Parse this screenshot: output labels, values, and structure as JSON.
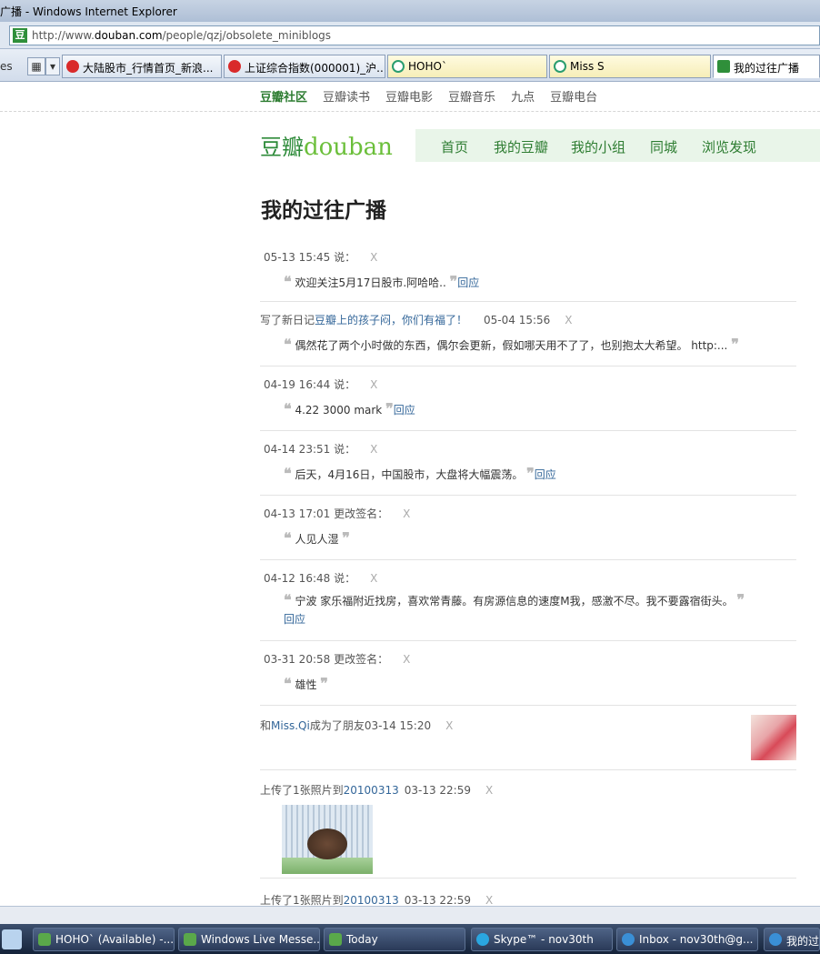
{
  "window": {
    "title": "广播 - Windows Internet Explorer",
    "url_prefix": "http://www.",
    "url_domain": "douban.com",
    "url_path": "/people/qzj/obsolete_miniblogs"
  },
  "tabs": {
    "left_stub": "es",
    "items": [
      {
        "label": "大陆股市_行情首页_新浪..."
      },
      {
        "label": "上证综合指数(000001)_沪..."
      },
      {
        "label": "HOHO`"
      },
      {
        "label": "Miss S"
      },
      {
        "label": "我的过往广播"
      }
    ]
  },
  "site": {
    "community_nav": [
      "豆瓣社区",
      "豆瓣读书",
      "豆瓣电影",
      "豆瓣音乐",
      "九点",
      "豆瓣电台"
    ],
    "logo_cn": "豆瓣",
    "logo_en": "douban",
    "main_nav": [
      "首页",
      "我的豆瓣",
      "我的小组",
      "同城",
      "浏览发现"
    ]
  },
  "page_title": "我的过往广播",
  "entries": [
    {
      "meta": "05-13 15:45 说：",
      "x": "X",
      "text": "欢迎关注5月17日股市.阿哈哈..",
      "reply": "回应"
    },
    {
      "meta_pre": "写了新日记",
      "meta_link": "豆瓣上的孩子闷，你们有福了！",
      "meta_time": "05-04 15:56",
      "x": "X",
      "text": "偶然花了两个小时做的东西，偶尔会更新，假如哪天用不了了，也别抱太大希望。 http:..."
    },
    {
      "meta": "04-19 16:44 说：",
      "x": "X",
      "text": "4.22 3000 mark",
      "reply": "回应"
    },
    {
      "meta": "04-14 23:51 说：",
      "x": "X",
      "text": "后天，4月16日，中国股市，大盘将大幅震荡。",
      "reply": "回应"
    },
    {
      "meta": "04-13 17:01 更改签名：",
      "x": "X",
      "text": "人见人湿"
    },
    {
      "meta": "04-12 16:48 说：",
      "x": "X",
      "text": "宁波 家乐福附近找房，喜欢常青藤。有房源信息的速度M我，感激不尽。我不要露宿街头。",
      "reply_1": "回",
      "reply_2": "应"
    },
    {
      "meta": "03-31 20:58 更改签名：",
      "x": "X",
      "text": "雄性"
    },
    {
      "meta_pre": "和",
      "meta_link": "Miss.Qi",
      "meta_post": "成为了朋友",
      "meta_time": "03-14 15:20",
      "x": "X"
    },
    {
      "meta_pre": "上传了1张照片到",
      "meta_link": "20100313",
      "meta_time": "03-13 22:59",
      "x": "X"
    },
    {
      "meta_pre": "上传了1张照片到",
      "meta_link": "20100313",
      "meta_time": "03-13 22:59",
      "x": "X"
    }
  ],
  "quote_open": "❝",
  "quote_close": "❞",
  "taskbar": [
    {
      "label": "HOHO` (Available) -..."
    },
    {
      "label": "Windows Live Messe..."
    },
    {
      "label": "Today"
    },
    {
      "label": "Skype™ - nov30th"
    },
    {
      "label": "Inbox - nov30th@g..."
    },
    {
      "label": "我的过"
    }
  ],
  "colors": {
    "accent_green": "#2e7d32",
    "link_blue": "#336699",
    "nav_bg": "#e9f5e9"
  },
  "icons": [
    "douban-favicon",
    "sina-icon",
    "circle-icon",
    "douban-tab-icon",
    "windows-start-icon"
  ]
}
